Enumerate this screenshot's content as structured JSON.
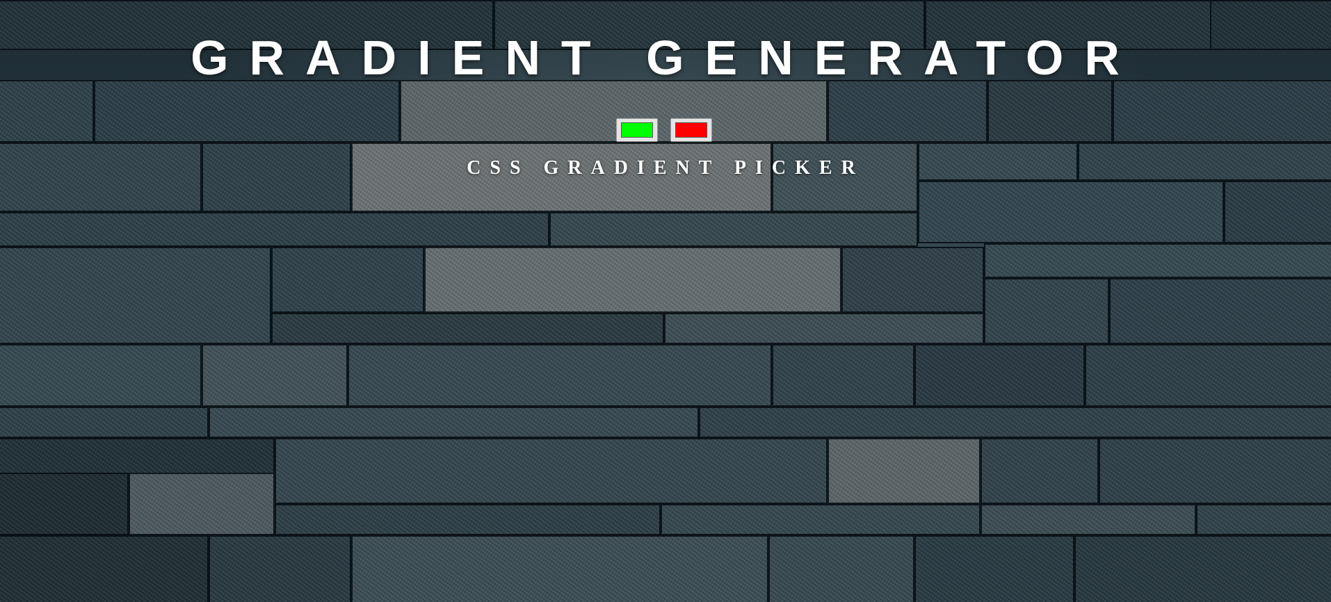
{
  "header": {
    "title": "GRADIENT GENERATOR",
    "subtitle": "CSS GRADIENT PICKER"
  },
  "color_pickers": [
    {
      "value": "#00ff00"
    },
    {
      "value": "#ff0000"
    }
  ],
  "colors": {
    "text": "#ffffff",
    "background": "#24343d"
  }
}
